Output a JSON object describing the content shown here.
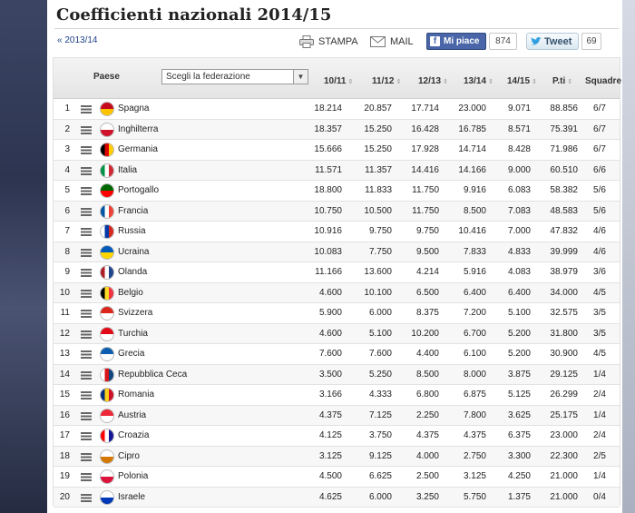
{
  "page": {
    "title": "Coefficienti nazionali 2014/15",
    "prev_season_link": "« 2013/14"
  },
  "toolbar": {
    "print_label": "STAMPA",
    "mail_label": "MAIL",
    "like_label": "Mi piace",
    "like_count": "874",
    "tweet_label": "Tweet",
    "tweet_count": "69"
  },
  "table": {
    "headers": {
      "country": "Paese",
      "season1": "10/11",
      "season2": "11/12",
      "season3": "12/13",
      "season4": "13/14",
      "season5": "14/15",
      "points": "P.ti",
      "teams": "Squadre"
    },
    "federation_select": {
      "selected": "Scegli la federazione"
    },
    "rows": [
      {
        "rank": "1",
        "country": "Spagna",
        "s1": "18.214",
        "s2": "20.857",
        "s3": "17.714",
        "s4": "23.000",
        "s5": "9.071",
        "points": "88.856",
        "teams": "6/7",
        "flag_colors": [
          "#c60b1e",
          "#ffc400"
        ]
      },
      {
        "rank": "2",
        "country": "Inghilterra",
        "s1": "18.357",
        "s2": "15.250",
        "s3": "16.428",
        "s4": "16.785",
        "s5": "8.571",
        "points": "75.391",
        "teams": "6/7",
        "flag_colors": [
          "#ffffff",
          "#cf142b"
        ]
      },
      {
        "rank": "3",
        "country": "Germania",
        "s1": "15.666",
        "s2": "15.250",
        "s3": "17.928",
        "s4": "14.714",
        "s5": "8.428",
        "points": "71.986",
        "teams": "6/7",
        "flag_colors": [
          "#000000",
          "#dd0000",
          "#ffce00"
        ]
      },
      {
        "rank": "4",
        "country": "Italia",
        "s1": "11.571",
        "s2": "11.357",
        "s3": "14.416",
        "s4": "14.166",
        "s5": "9.000",
        "points": "60.510",
        "teams": "6/6",
        "flag_colors": [
          "#009246",
          "#ffffff",
          "#ce2b37"
        ]
      },
      {
        "rank": "5",
        "country": "Portogallo",
        "s1": "18.800",
        "s2": "11.833",
        "s3": "11.750",
        "s4": "9.916",
        "s5": "6.083",
        "points": "58.382",
        "teams": "5/6",
        "flag_colors": [
          "#006600",
          "#ff0000"
        ]
      },
      {
        "rank": "6",
        "country": "Francia",
        "s1": "10.750",
        "s2": "10.500",
        "s3": "11.750",
        "s4": "8.500",
        "s5": "7.083",
        "points": "48.583",
        "teams": "5/6",
        "flag_colors": [
          "#0055a4",
          "#ffffff",
          "#ef4135"
        ]
      },
      {
        "rank": "7",
        "country": "Russia",
        "s1": "10.916",
        "s2": "9.750",
        "s3": "9.750",
        "s4": "10.416",
        "s5": "7.000",
        "points": "47.832",
        "teams": "4/6",
        "flag_colors": [
          "#ffffff",
          "#0039a6",
          "#d52b1e"
        ]
      },
      {
        "rank": "8",
        "country": "Ucraina",
        "s1": "10.083",
        "s2": "7.750",
        "s3": "9.500",
        "s4": "7.833",
        "s5": "4.833",
        "points": "39.999",
        "teams": "4/6",
        "flag_colors": [
          "#005bbb",
          "#ffd500"
        ]
      },
      {
        "rank": "9",
        "country": "Olanda",
        "s1": "11.166",
        "s2": "13.600",
        "s3": "4.214",
        "s4": "5.916",
        "s5": "4.083",
        "points": "38.979",
        "teams": "3/6",
        "flag_colors": [
          "#ae1c28",
          "#ffffff",
          "#21468b"
        ]
      },
      {
        "rank": "10",
        "country": "Belgio",
        "s1": "4.600",
        "s2": "10.100",
        "s3": "6.500",
        "s4": "6.400",
        "s5": "6.400",
        "points": "34.000",
        "teams": "4/5",
        "flag_colors": [
          "#000000",
          "#fdda24",
          "#ef3340"
        ]
      },
      {
        "rank": "11",
        "country": "Svizzera",
        "s1": "5.900",
        "s2": "6.000",
        "s3": "8.375",
        "s4": "7.200",
        "s5": "5.100",
        "points": "32.575",
        "teams": "3/5",
        "flag_colors": [
          "#da291c",
          "#ffffff"
        ]
      },
      {
        "rank": "12",
        "country": "Turchia",
        "s1": "4.600",
        "s2": "5.100",
        "s3": "10.200",
        "s4": "6.700",
        "s5": "5.200",
        "points": "31.800",
        "teams": "3/5",
        "flag_colors": [
          "#e30a17",
          "#ffffff"
        ]
      },
      {
        "rank": "13",
        "country": "Grecia",
        "s1": "7.600",
        "s2": "7.600",
        "s3": "4.400",
        "s4": "6.100",
        "s5": "5.200",
        "points": "30.900",
        "teams": "4/5",
        "flag_colors": [
          "#0d5eaf",
          "#ffffff"
        ]
      },
      {
        "rank": "14",
        "country": "Repubblica Ceca",
        "s1": "3.500",
        "s2": "5.250",
        "s3": "8.500",
        "s4": "8.000",
        "s5": "3.875",
        "points": "29.125",
        "teams": "1/4",
        "flag_colors": [
          "#ffffff",
          "#d7141a",
          "#11457e"
        ]
      },
      {
        "rank": "15",
        "country": "Romania",
        "s1": "3.166",
        "s2": "4.333",
        "s3": "6.800",
        "s4": "6.875",
        "s5": "5.125",
        "points": "26.299",
        "teams": "2/4",
        "flag_colors": [
          "#002b7f",
          "#fcd116",
          "#ce1126"
        ]
      },
      {
        "rank": "16",
        "country": "Austria",
        "s1": "4.375",
        "s2": "7.125",
        "s3": "2.250",
        "s4": "7.800",
        "s5": "3.625",
        "points": "25.175",
        "teams": "1/4",
        "flag_colors": [
          "#ed2939",
          "#ffffff"
        ]
      },
      {
        "rank": "17",
        "country": "Croazia",
        "s1": "4.125",
        "s2": "3.750",
        "s3": "4.375",
        "s4": "4.375",
        "s5": "6.375",
        "points": "23.000",
        "teams": "2/4",
        "flag_colors": [
          "#ff0000",
          "#ffffff",
          "#171796"
        ]
      },
      {
        "rank": "18",
        "country": "Cipro",
        "s1": "3.125",
        "s2": "9.125",
        "s3": "4.000",
        "s4": "2.750",
        "s5": "3.300",
        "points": "22.300",
        "teams": "2/5",
        "flag_colors": [
          "#ffffff",
          "#d57800"
        ]
      },
      {
        "rank": "19",
        "country": "Polonia",
        "s1": "4.500",
        "s2": "6.625",
        "s3": "2.500",
        "s4": "3.125",
        "s5": "4.250",
        "points": "21.000",
        "teams": "1/4",
        "flag_colors": [
          "#ffffff",
          "#dc143c"
        ]
      },
      {
        "rank": "20",
        "country": "Israele",
        "s1": "4.625",
        "s2": "6.000",
        "s3": "3.250",
        "s4": "5.750",
        "s5": "1.375",
        "points": "21.000",
        "teams": "0/4",
        "flag_colors": [
          "#ffffff",
          "#0038b8"
        ]
      }
    ]
  }
}
